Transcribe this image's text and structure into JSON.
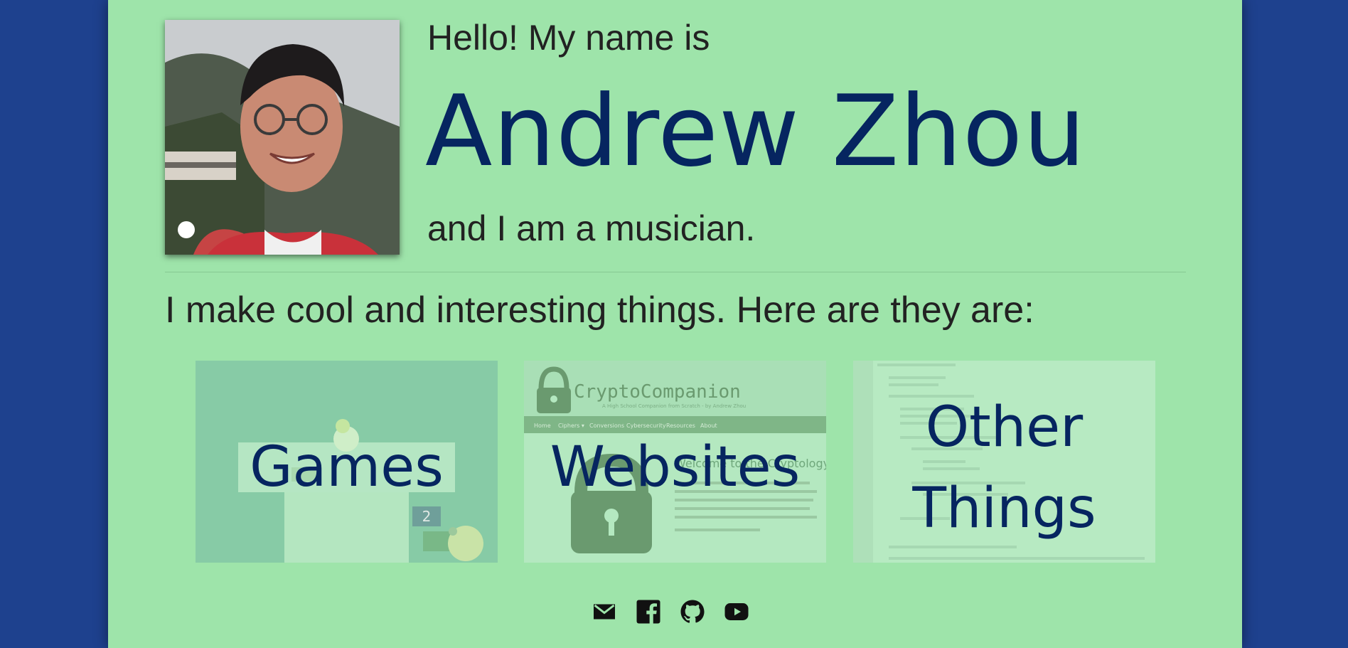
{
  "header": {
    "greeting": "Hello! My name is",
    "name": "Andrew Zhou",
    "role": "and I am a musician."
  },
  "intro": "I make cool and interesting things. Here are they are:",
  "tiles": [
    {
      "label": "Games"
    },
    {
      "label": "Websites",
      "screenshot_title": "CryptoCompanion",
      "screenshot_subtitle": "A High School Companion from Scratch - by Andrew Zhou",
      "screenshot_nav": [
        "Home",
        "Ciphers ▾",
        "Conversions",
        "Cybersecurity",
        "Resources",
        "About"
      ],
      "screenshot_heading": "Welcome to the Cryptology Co"
    },
    {
      "label_line1": "Other",
      "label_line2": "Things"
    }
  ],
  "socials": [
    {
      "name": "mail-icon"
    },
    {
      "name": "facebook-icon"
    },
    {
      "name": "github-icon"
    },
    {
      "name": "youtube-icon"
    }
  ],
  "colors": {
    "page_background": "#1e418e",
    "card_background": "#9ee4aa",
    "name_color": "#062560",
    "text_color": "#222222"
  }
}
